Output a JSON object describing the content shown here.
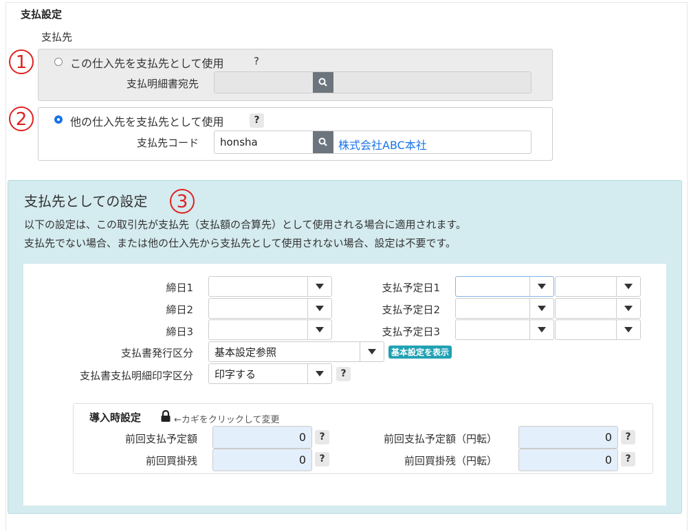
{
  "section_title": "支払設定",
  "payee_label": "支払先",
  "markers": [
    "1",
    "2",
    "3"
  ],
  "option_self": {
    "label": "この仕入先を支払先として使用",
    "help": "?",
    "field_label": "支払明細書宛先",
    "field_value": "",
    "selected": false
  },
  "option_other": {
    "label": "他の仕入先を支払先として使用",
    "help": "?",
    "field_label": "支払先コード",
    "field_value": "honsha",
    "link_text": "株式会社ABC本社",
    "selected": true
  },
  "payee_settings": {
    "title": "支払先としての設定",
    "desc1": "以下の設定は、この取引先が支払先（支払額の合算先）として使用される場合に適用されます。",
    "desc2": "支払先でない場合、または他の仕入先から支払先として使用されない場合、設定は不要です。",
    "closing_days": [
      {
        "label": "締日1",
        "value": ""
      },
      {
        "label": "締日2",
        "value": ""
      },
      {
        "label": "締日3",
        "value": ""
      }
    ],
    "payment_dates": [
      {
        "label": "支払予定日1",
        "value1": "",
        "value2": ""
      },
      {
        "label": "支払予定日2",
        "value1": "",
        "value2": ""
      },
      {
        "label": "支払予定日3",
        "value1": "",
        "value2": ""
      }
    ],
    "issue_type": {
      "label": "支払書発行区分",
      "value": "基本設定参照",
      "badge": "基本設定を表示"
    },
    "print_type": {
      "label": "支払書支払明細印字区分",
      "value": "印字する",
      "help": "?"
    }
  },
  "import_settings": {
    "title": "導入時設定",
    "lock_hint": "←カギをクリックして変更",
    "fields": [
      {
        "label": "前回支払予定額",
        "value": "0",
        "help": "?"
      },
      {
        "label": "前回支払予定額（円転）",
        "value": "0",
        "help": "?"
      },
      {
        "label": "前回買掛残",
        "value": "0",
        "help": "?"
      },
      {
        "label": "前回買掛残（円転）",
        "value": "0",
        "help": "?"
      }
    ]
  },
  "colors": {
    "accent": "#1a73e8",
    "marker": "#e02020",
    "section_bg": "#d4ebef",
    "badge": "#20a1b3"
  }
}
